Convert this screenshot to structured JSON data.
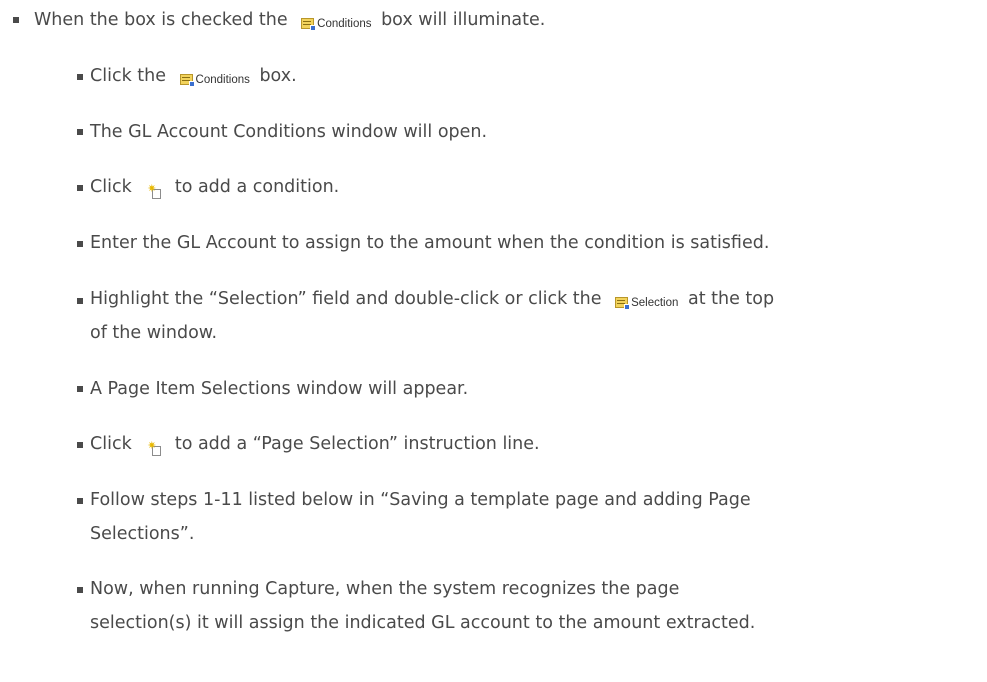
{
  "items": [
    {
      "text_before": "When the box is checked the ",
      "button": "Conditions",
      "text_after": " box will illuminate."
    },
    {
      "text_before": "Click the ",
      "button": "Conditions",
      "text_after": " box."
    },
    {
      "text": "The GL Account Conditions window will open."
    },
    {
      "text_before": "Click ",
      "icon_name": "new-item-icon",
      "text_after": " to add a condition."
    },
    {
      "text": "Enter the GL Account to assign to the amount when the condition is satisfied."
    },
    {
      "text_before": "Highlight the “Selection” field and double-click or click the ",
      "button": "Selection",
      "text_after": " at the top",
      "line2": "of the window."
    },
    {
      "text": "A Page Item Selections window will appear."
    },
    {
      "text_before": "Click ",
      "icon_name": "new-item-icon",
      "text_after": " to add a “Page Selection” instruction line."
    },
    {
      "text": "Follow steps 1-11 listed below in “Saving a template page and adding Page",
      "line2": "Selections”."
    },
    {
      "text": "Now, when running Capture, when the system recognizes the page",
      "line2": "selection(s) it will assign the indicated GL account to the amount extracted."
    }
  ]
}
